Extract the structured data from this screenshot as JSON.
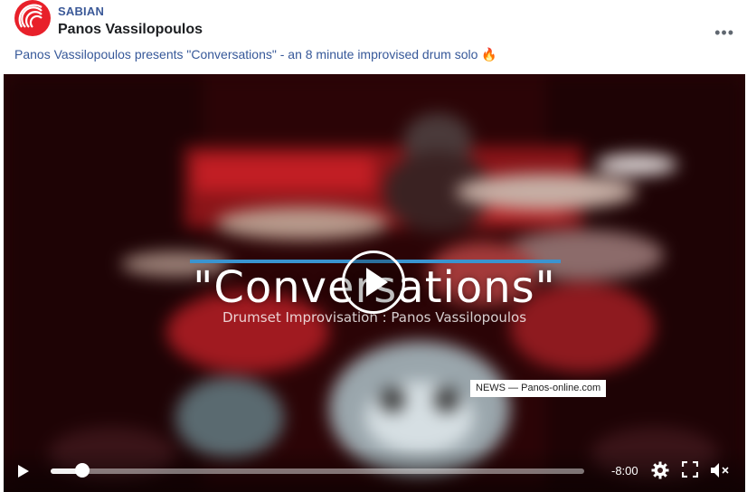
{
  "post": {
    "page_name": "SABIAN",
    "author": "Panos Vassilopoulos",
    "more_label": "•••",
    "caption": "Panos Vassilopoulos presents \"Conversations\" - an 8 minute improvised drum solo 🔥"
  },
  "video": {
    "title": "\"Conversations\"",
    "subtitle": "Drumset Improvisation : Panos Vassilopoulos",
    "watermark": "NEWS — Panos-online.com",
    "time_remaining": "-8:00",
    "progress": 0.06
  },
  "icons": {
    "avatar": "sabian-logo-icon",
    "more": "more-options-icon",
    "play_large": "play-icon",
    "play": "play-icon",
    "settings": "gear-icon",
    "fullscreen": "fullscreen-icon",
    "volume": "volume-muted-icon"
  },
  "colors": {
    "brand_red": "#e8202a",
    "link_blue": "#365899",
    "title_underline": "#3a94d0"
  }
}
